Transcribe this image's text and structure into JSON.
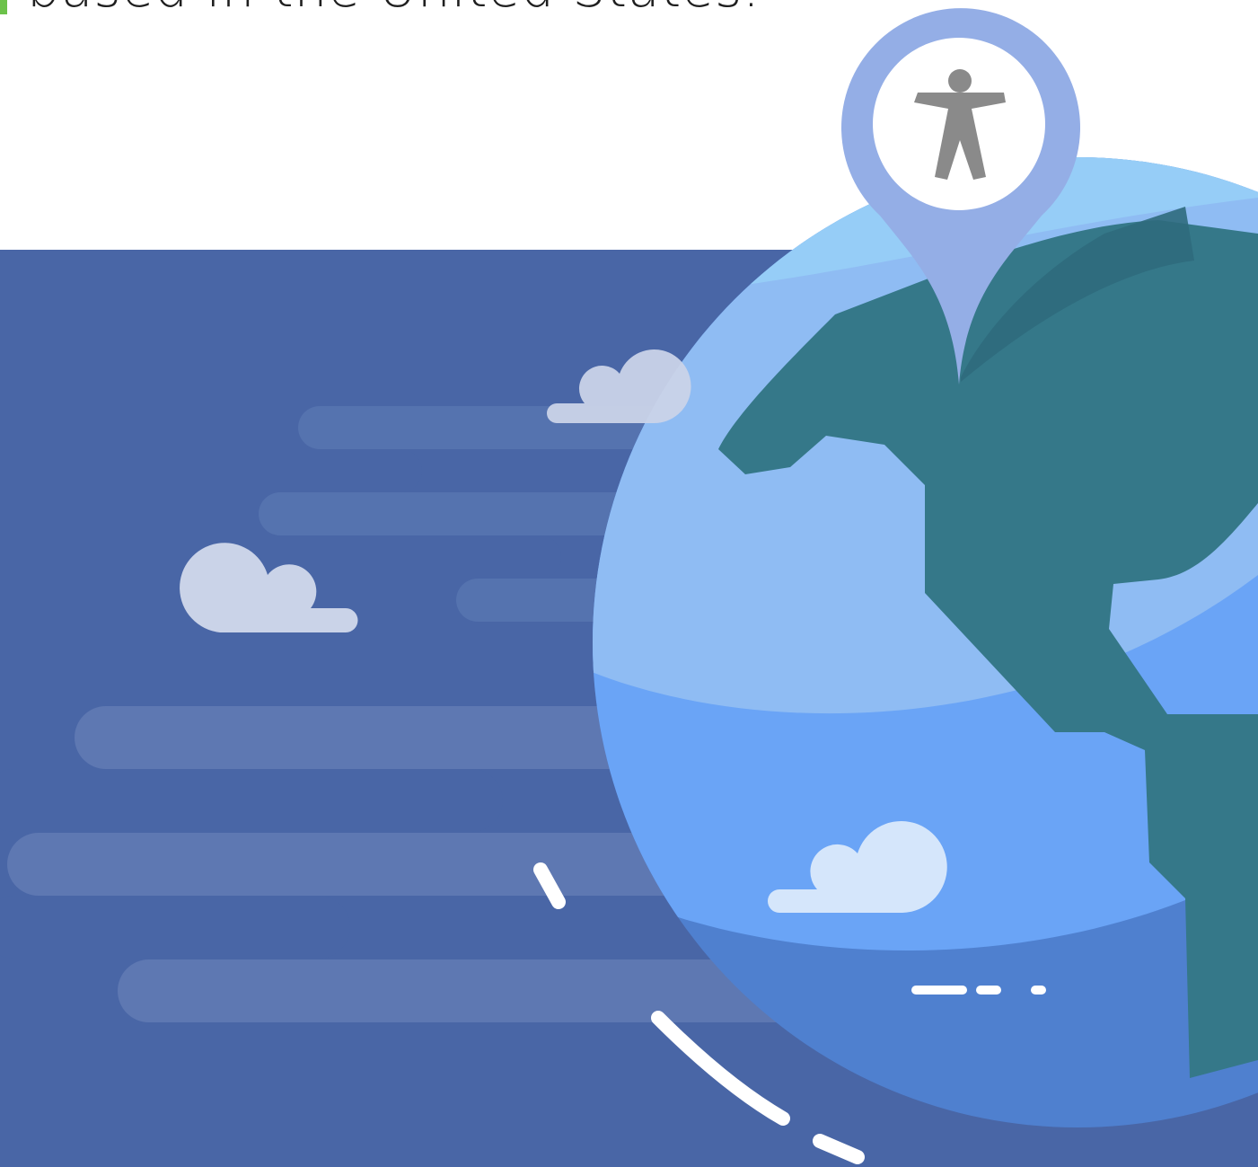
{
  "headline": {
    "text": "based in the United States."
  },
  "illustration": {
    "subject": "globe with location pin",
    "pin_icon": "accessibility-icon",
    "colors": {
      "accent": "#6cc24a",
      "panel_bg": "#4966a6",
      "streak": "#5e78b2",
      "globe_light": "#8fbcf3",
      "globe_mid": "#6aa4f6",
      "globe_dark": "#4f80cf",
      "land": "#357889",
      "land_shadow": "#2f6a7d",
      "pin": "#94aee6",
      "cloud": "#cad3e8",
      "cloud_light": "#d5e6fb",
      "figure": "#8a8a8a"
    }
  }
}
